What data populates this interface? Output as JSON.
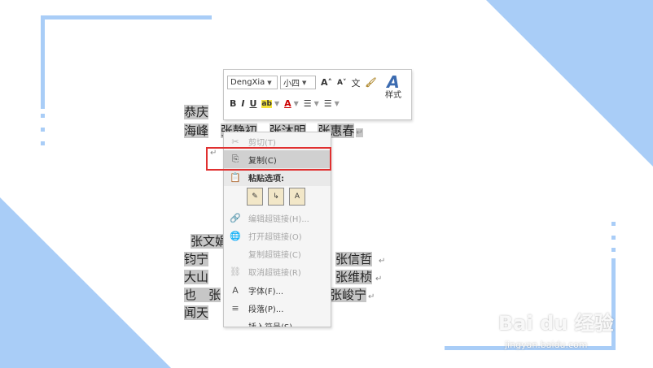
{
  "document": {
    "lines": [
      {
        "pre": "恭庆",
        "names": [],
        "mark": ""
      },
      {
        "pre": "海峰",
        "names": [
          "张静初",
          "张沐明",
          "张惠春"
        ],
        "mark": "↵"
      },
      {
        "pre": "",
        "names": [],
        "mark": "↵"
      },
      {
        "pre": "张文娟",
        "names": [],
        "mark": ""
      },
      {
        "pre": "钧宁",
        "names": [
          "张信哲"
        ],
        "mark": "↵"
      },
      {
        "pre": "大山",
        "names": [
          "张维桢"
        ],
        "mark": "↵"
      },
      {
        "pre": "也　张",
        "names": [
          "张峻宁"
        ],
        "mark": "↵"
      },
      {
        "pre": "闻天",
        "names": [],
        "mark": ""
      }
    ]
  },
  "toolbar": {
    "font_name": "DengXia",
    "font_size": "小四",
    "grow_font": "A˄",
    "shrink_font": "A˅",
    "phonetic": "文",
    "bold": "B",
    "italic": "I",
    "underline": "U",
    "highlight": "ab",
    "font_color": "A",
    "styles_label": "样式"
  },
  "context_menu": {
    "items": [
      {
        "icon": "✂",
        "label": "剪切(T)",
        "state": "disabled"
      },
      {
        "icon": "⎘",
        "label": "复制(C)",
        "state": "selected"
      },
      {
        "icon": "📋",
        "label": "粘贴选项:",
        "state": "header"
      },
      {
        "icon": "🔗",
        "label": "编辑超链接(H)...",
        "state": "disabled"
      },
      {
        "icon": "🌐",
        "label": "打开超链接(O)",
        "state": "disabled"
      },
      {
        "icon": "",
        "label": "复制超链接(C)",
        "state": "disabled"
      },
      {
        "icon": "⛓",
        "label": "取消超链接(R)",
        "state": "disabled"
      },
      {
        "icon": "A",
        "label": "字体(F)...",
        "state": "normal"
      },
      {
        "icon": "≡",
        "label": "段落(P)...",
        "state": "normal"
      },
      {
        "icon": "",
        "label": "插入符号(S)",
        "state": "normal"
      }
    ],
    "paste_options": [
      "keep-source-format-icon",
      "merge-format-icon",
      "keep-text-only-icon"
    ]
  },
  "watermark": {
    "main": "Bai du 经验",
    "sub": "jingyan.baidu.com"
  },
  "colors": {
    "accent_blue": "#a9cdf7",
    "highlight_red": "#e03030"
  }
}
